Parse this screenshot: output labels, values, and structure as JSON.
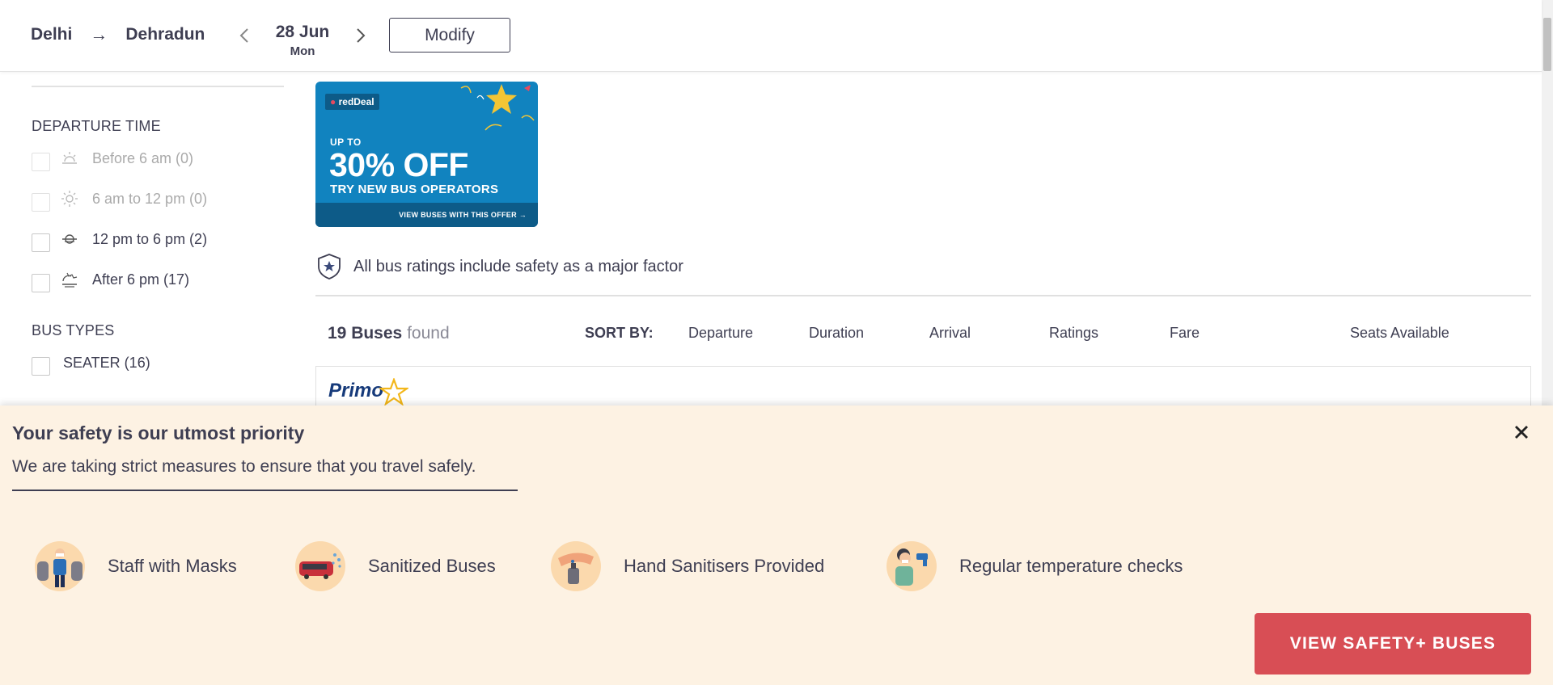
{
  "header": {
    "from": "Delhi",
    "to": "Dehradun",
    "arrow": "→",
    "date": "28 Jun",
    "day": "Mon",
    "prev_chevron": "‹",
    "next_chevron": "›",
    "modify_label": "Modify"
  },
  "sidebar": {
    "departure_title": "DEPARTURE TIME",
    "departure_options": [
      {
        "label": "Before 6 am (0)",
        "icon": "sunrise-icon",
        "disabled": true
      },
      {
        "label": "6 am to 12 pm (0)",
        "icon": "sun-icon",
        "disabled": true
      },
      {
        "label": "12 pm to 6 pm (2)",
        "icon": "sun-horizon-icon",
        "disabled": false
      },
      {
        "label": "After 6 pm (17)",
        "icon": "sunset-icon",
        "disabled": false
      }
    ],
    "bus_types_title": "BUS TYPES",
    "bus_types": [
      {
        "label": "SEATER (16)"
      }
    ]
  },
  "promo": {
    "tag": "redDeal",
    "upto": "UP TO",
    "discount": "30% OFF",
    "tagline": "TRY NEW BUS OPERATORS",
    "cta": "VIEW BUSES WITH THIS OFFER →",
    "bg_color": "#1183bf"
  },
  "safety_note": {
    "text": "All bus ratings include safety as a major factor",
    "icon": "shield-star-icon"
  },
  "results": {
    "count": "19 Buses",
    "found": "found",
    "sort_by_label": "SORT BY:",
    "sort_options": [
      "Departure",
      "Duration",
      "Arrival",
      "Ratings",
      "Fare",
      "Seats Available"
    ]
  },
  "bus_card": {
    "operator_logo_text": "Primo"
  },
  "safety_overlay": {
    "title": "Your safety is our utmost priority",
    "subtitle": "We are taking strict measures to ensure that you travel safely.",
    "close_icon": "close-icon",
    "features": [
      {
        "label": "Staff with Masks",
        "icon": "staff-mask-icon"
      },
      {
        "label": "Sanitized Buses",
        "icon": "sanitized-bus-icon"
      },
      {
        "label": "Hand Sanitisers Provided",
        "icon": "hand-sanitiser-icon"
      },
      {
        "label": "Regular temperature checks",
        "icon": "temperature-check-icon"
      }
    ],
    "cta_label": "VIEW SAFETY+ BUSES",
    "bg_color": "#fdf2e3",
    "cta_color": "#d84e55"
  }
}
